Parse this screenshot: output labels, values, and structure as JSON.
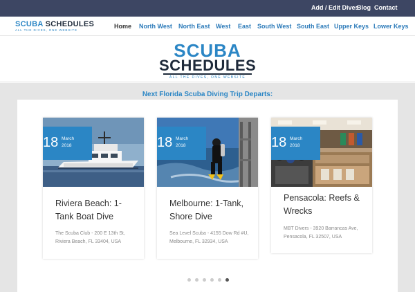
{
  "topbar": {
    "links": [
      "Add / Edit Dives",
      "Blog",
      "Contact"
    ]
  },
  "header": {
    "logo_scuba": "SCUBA",
    "logo_schedules": "SCHEDULES",
    "logo_tagline": "ALL THE DIVES, ONE WEBSITE",
    "nav": [
      "Home",
      "North West",
      "North East",
      "West",
      "East",
      "South West",
      "South East",
      "Upper Keys",
      "Lower Keys"
    ]
  },
  "hero": {
    "logo_scuba": "SCUBA",
    "logo_schedules": "SCHEDULES",
    "logo_tagline": "ALL THE DIVES, ONE WEBSITE"
  },
  "main": {
    "heading": "Next Florida Scuba Diving Trip Departs:",
    "cards": [
      {
        "day": "18",
        "month": "March",
        "year": "2018",
        "title": "Riviera Beach: 1-Tank Boat Dive",
        "address": "The Scuba Club - 200 E 13th St, Riviera Beach, FL 33404, USA"
      },
      {
        "day": "18",
        "month": "March",
        "year": "2018",
        "title": "Melbourne: 1-Tank, Shore Dive",
        "address": "Sea Level Scuba - 4155 Dow Rd #U, Melbourne, FL 32934, USA"
      },
      {
        "day": "18",
        "month": "March",
        "year": "2018",
        "title": "Pensacola: Reefs & Wrecks",
        "address": "MBT Divers - 3920 Barrancas Ave, Pensacola, FL 32507, USA"
      }
    ],
    "pagination": {
      "count": 6,
      "active_index": 5
    }
  },
  "colors": {
    "topbar": "#3d4663",
    "brand_blue": "#2b86c5",
    "logo_dark": "#1e2a3a",
    "page_bg": "#e5e5e5"
  }
}
